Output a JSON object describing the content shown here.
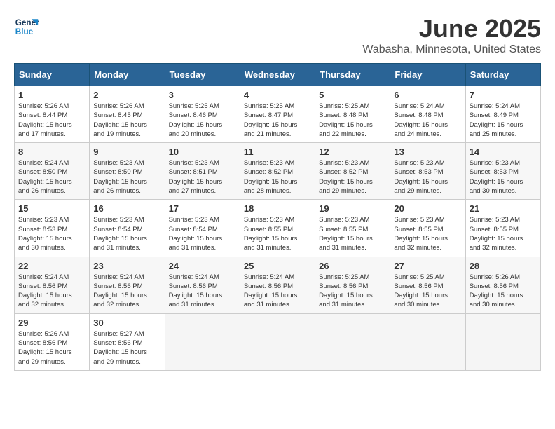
{
  "logo": {
    "line1": "General",
    "line2": "Blue"
  },
  "title": "June 2025",
  "location": "Wabasha, Minnesota, United States",
  "headers": [
    "Sunday",
    "Monday",
    "Tuesday",
    "Wednesday",
    "Thursday",
    "Friday",
    "Saturday"
  ],
  "weeks": [
    [
      {
        "day": "1",
        "sunrise": "5:26 AM",
        "sunset": "8:44 PM",
        "daylight": "15 hours and 17 minutes."
      },
      {
        "day": "2",
        "sunrise": "5:26 AM",
        "sunset": "8:45 PM",
        "daylight": "15 hours and 19 minutes."
      },
      {
        "day": "3",
        "sunrise": "5:25 AM",
        "sunset": "8:46 PM",
        "daylight": "15 hours and 20 minutes."
      },
      {
        "day": "4",
        "sunrise": "5:25 AM",
        "sunset": "8:47 PM",
        "daylight": "15 hours and 21 minutes."
      },
      {
        "day": "5",
        "sunrise": "5:25 AM",
        "sunset": "8:48 PM",
        "daylight": "15 hours and 22 minutes."
      },
      {
        "day": "6",
        "sunrise": "5:24 AM",
        "sunset": "8:48 PM",
        "daylight": "15 hours and 24 minutes."
      },
      {
        "day": "7",
        "sunrise": "5:24 AM",
        "sunset": "8:49 PM",
        "daylight": "15 hours and 25 minutes."
      }
    ],
    [
      {
        "day": "8",
        "sunrise": "5:24 AM",
        "sunset": "8:50 PM",
        "daylight": "15 hours and 26 minutes."
      },
      {
        "day": "9",
        "sunrise": "5:23 AM",
        "sunset": "8:50 PM",
        "daylight": "15 hours and 26 minutes."
      },
      {
        "day": "10",
        "sunrise": "5:23 AM",
        "sunset": "8:51 PM",
        "daylight": "15 hours and 27 minutes."
      },
      {
        "day": "11",
        "sunrise": "5:23 AM",
        "sunset": "8:52 PM",
        "daylight": "15 hours and 28 minutes."
      },
      {
        "day": "12",
        "sunrise": "5:23 AM",
        "sunset": "8:52 PM",
        "daylight": "15 hours and 29 minutes."
      },
      {
        "day": "13",
        "sunrise": "5:23 AM",
        "sunset": "8:53 PM",
        "daylight": "15 hours and 29 minutes."
      },
      {
        "day": "14",
        "sunrise": "5:23 AM",
        "sunset": "8:53 PM",
        "daylight": "15 hours and 30 minutes."
      }
    ],
    [
      {
        "day": "15",
        "sunrise": "5:23 AM",
        "sunset": "8:53 PM",
        "daylight": "15 hours and 30 minutes."
      },
      {
        "day": "16",
        "sunrise": "5:23 AM",
        "sunset": "8:54 PM",
        "daylight": "15 hours and 31 minutes."
      },
      {
        "day": "17",
        "sunrise": "5:23 AM",
        "sunset": "8:54 PM",
        "daylight": "15 hours and 31 minutes."
      },
      {
        "day": "18",
        "sunrise": "5:23 AM",
        "sunset": "8:55 PM",
        "daylight": "15 hours and 31 minutes."
      },
      {
        "day": "19",
        "sunrise": "5:23 AM",
        "sunset": "8:55 PM",
        "daylight": "15 hours and 31 minutes."
      },
      {
        "day": "20",
        "sunrise": "5:23 AM",
        "sunset": "8:55 PM",
        "daylight": "15 hours and 32 minutes."
      },
      {
        "day": "21",
        "sunrise": "5:23 AM",
        "sunset": "8:55 PM",
        "daylight": "15 hours and 32 minutes."
      }
    ],
    [
      {
        "day": "22",
        "sunrise": "5:24 AM",
        "sunset": "8:56 PM",
        "daylight": "15 hours and 32 minutes."
      },
      {
        "day": "23",
        "sunrise": "5:24 AM",
        "sunset": "8:56 PM",
        "daylight": "15 hours and 32 minutes."
      },
      {
        "day": "24",
        "sunrise": "5:24 AM",
        "sunset": "8:56 PM",
        "daylight": "15 hours and 31 minutes."
      },
      {
        "day": "25",
        "sunrise": "5:24 AM",
        "sunset": "8:56 PM",
        "daylight": "15 hours and 31 minutes."
      },
      {
        "day": "26",
        "sunrise": "5:25 AM",
        "sunset": "8:56 PM",
        "daylight": "15 hours and 31 minutes."
      },
      {
        "day": "27",
        "sunrise": "5:25 AM",
        "sunset": "8:56 PM",
        "daylight": "15 hours and 30 minutes."
      },
      {
        "day": "28",
        "sunrise": "5:26 AM",
        "sunset": "8:56 PM",
        "daylight": "15 hours and 30 minutes."
      }
    ],
    [
      {
        "day": "29",
        "sunrise": "5:26 AM",
        "sunset": "8:56 PM",
        "daylight": "15 hours and 29 minutes."
      },
      {
        "day": "30",
        "sunrise": "5:27 AM",
        "sunset": "8:56 PM",
        "daylight": "15 hours and 29 minutes."
      },
      null,
      null,
      null,
      null,
      null
    ]
  ],
  "labels": {
    "sunrise": "Sunrise: ",
    "sunset": "Sunset: ",
    "daylight": "Daylight: "
  }
}
